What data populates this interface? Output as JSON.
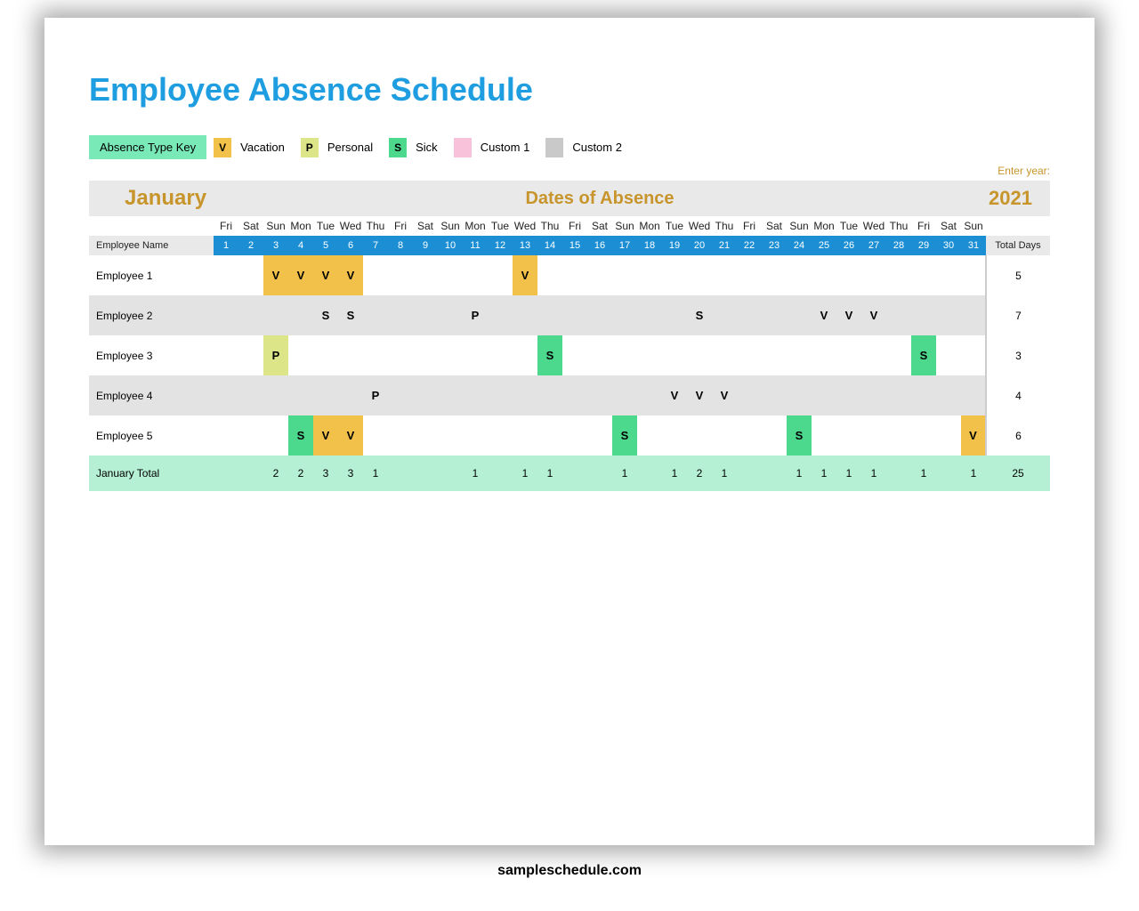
{
  "title": "Employee Absence Schedule",
  "legend": {
    "keyLabel": "Absence Type Key",
    "items": [
      {
        "code": "V",
        "name": "Vacation",
        "cls": "vac"
      },
      {
        "code": "P",
        "name": "Personal",
        "cls": "per"
      },
      {
        "code": "S",
        "name": "Sick",
        "cls": "sic"
      },
      {
        "code": "",
        "name": "Custom 1",
        "cls": "c1"
      },
      {
        "code": "",
        "name": "Custom 2",
        "cls": "c2"
      }
    ]
  },
  "enterYearLabel": "Enter year:",
  "month": "January",
  "datesHeading": "Dates of Absence",
  "year": "2021",
  "nameHeader": "Employee Name",
  "totalHeader": "Total Days",
  "dow": [
    "Fri",
    "Sat",
    "Sun",
    "Mon",
    "Tue",
    "Wed",
    "Thu",
    "Fri",
    "Sat",
    "Sun",
    "Mon",
    "Tue",
    "Wed",
    "Thu",
    "Fri",
    "Sat",
    "Sun",
    "Mon",
    "Tue",
    "Wed",
    "Thu",
    "Fri",
    "Sat",
    "Sun",
    "Mon",
    "Tue",
    "Wed",
    "Thu",
    "Fri",
    "Sat",
    "Sun"
  ],
  "dates": [
    1,
    2,
    3,
    4,
    5,
    6,
    7,
    8,
    9,
    10,
    11,
    12,
    13,
    14,
    15,
    16,
    17,
    18,
    19,
    20,
    21,
    22,
    23,
    24,
    25,
    26,
    27,
    28,
    29,
    30,
    31
  ],
  "employees": [
    {
      "name": "Employee 1",
      "total": 5,
      "cells": {
        "3": "V",
        "4": "V",
        "5": "V",
        "6": "V",
        "13": "V"
      }
    },
    {
      "name": "Employee 2",
      "total": 7,
      "cells": {
        "5": "S",
        "6": "S",
        "11": "P",
        "20": "S",
        "25": "V",
        "26": "V",
        "27": "V"
      }
    },
    {
      "name": "Employee 3",
      "total": 3,
      "cells": {
        "3": "P",
        "14": "S",
        "29": "S"
      }
    },
    {
      "name": "Employee 4",
      "total": 4,
      "cells": {
        "7": "P",
        "19": "V",
        "20": "V",
        "21": "V"
      }
    },
    {
      "name": "Employee 5",
      "total": 6,
      "cells": {
        "4": "S",
        "5": "V",
        "6": "V",
        "17": "S",
        "24": "S",
        "31": "V"
      }
    }
  ],
  "totalsRow": {
    "label": "January Total",
    "grand": 25,
    "values": {
      "3": 2,
      "4": 2,
      "5": 3,
      "6": 3,
      "7": 1,
      "11": 1,
      "13": 1,
      "14": 1,
      "17": 1,
      "19": 1,
      "20": 2,
      "21": 1,
      "24": 1,
      "25": 1,
      "26": 1,
      "27": 1,
      "29": 1,
      "31": 1
    }
  },
  "codeToClass": {
    "V": "vac",
    "P": "per",
    "S": "sic"
  },
  "source": "sampleschedule.com"
}
